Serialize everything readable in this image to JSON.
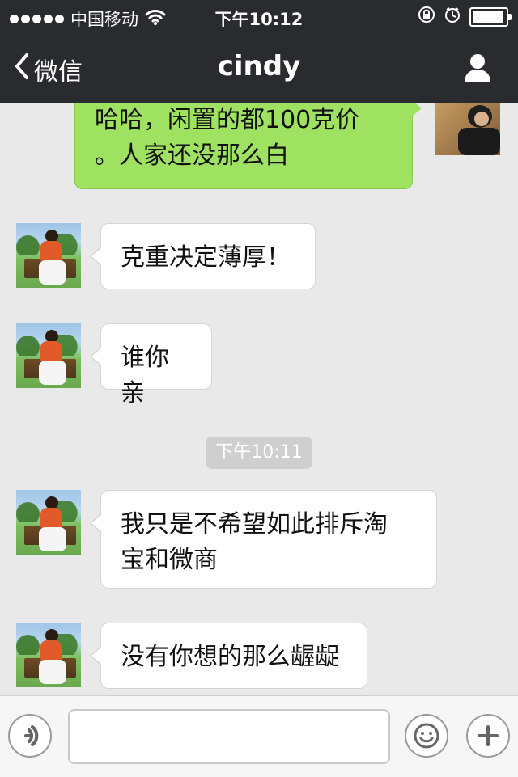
{
  "status_bar": {
    "carrier": "中国移动",
    "time": "下午10:12"
  },
  "nav": {
    "back_label": "微信",
    "title": "cindy"
  },
  "messages": [
    {
      "side": "right",
      "text_lines": [
        "哈哈，闲置的都100克价",
        "。人家还没那么白"
      ]
    },
    {
      "side": "left",
      "text_lines": [
        "克重决定薄厚！"
      ]
    },
    {
      "side": "left",
      "text_lines": [
        "谁你亲"
      ]
    },
    {
      "side": "left",
      "text_lines": [
        "我只是不希望如此排斥淘",
        "宝和微商"
      ]
    },
    {
      "side": "left",
      "text_lines": [
        "没有你想的那么龌龊"
      ]
    }
  ],
  "timestamp": "下午10:11",
  "input": {
    "placeholder": ""
  },
  "icons": {
    "back": "chevron-left-icon",
    "user": "user-icon",
    "voice": "voice-icon",
    "emoji": "emoji-icon",
    "plus": "plus-icon",
    "wifi": "wifi-icon",
    "lock": "rotation-lock-icon",
    "alarm": "alarm-icon",
    "battery": "battery-icon"
  },
  "battery_level": 0.95
}
